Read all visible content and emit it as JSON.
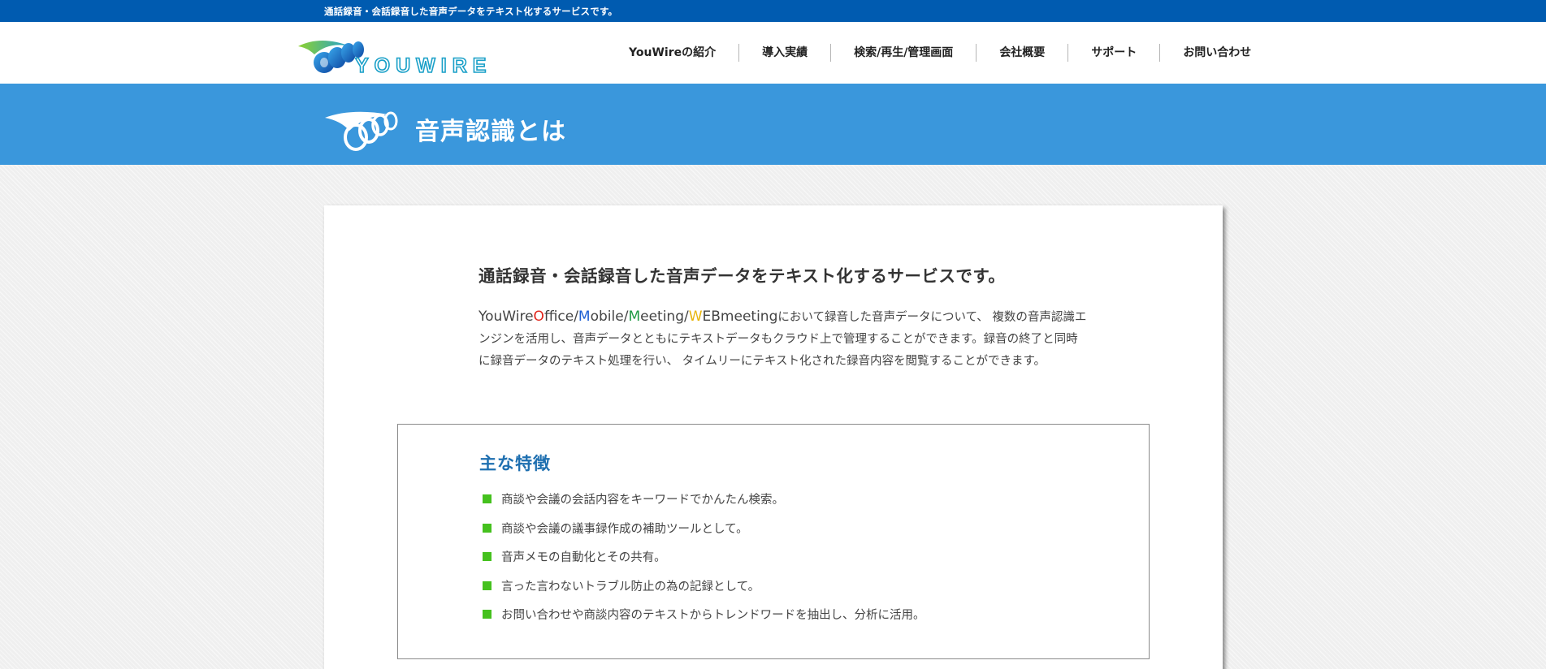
{
  "topbar": {
    "tagline": "通話録音・会話録音した音声データをテキスト化するサービスです。"
  },
  "header": {
    "logo_text": "YOUWIRE",
    "nav": [
      {
        "label": "YouWireの紹介"
      },
      {
        "label": "導入実績"
      },
      {
        "label": "検索/再生/管理画面"
      },
      {
        "label": "会社概要"
      },
      {
        "label": "サポート"
      },
      {
        "label": "お問い合わせ"
      }
    ]
  },
  "hero": {
    "title": "音声認識とは"
  },
  "main": {
    "lead_title": "通話録音・会話録音した音声データをテキスト化するサービスです。",
    "brand": {
      "you_wire": "YouWire",
      "o": "O",
      "ffice": "ffice",
      "m1": "M",
      "obile": "obile",
      "m2": "M",
      "eeting": "eeting",
      "w": "W",
      "ebmeeting": "EBmeeting",
      "slash": "/"
    },
    "description_rest": "において録音した音声データについて、 複数の音声認識エンジンを活用し、音声データとともにテキストデータもクラウド上で管理することができます。録音の終了と同時に録音データのテキスト処理を行い、 タイムリーにテキスト化された録音内容を閲覧することができます。",
    "features": {
      "title": "主な特徴",
      "items": [
        "商談や会議の会話内容をキーワードでかんたん検索。",
        "商談や会議の議事録作成の補助ツールとして。",
        "音声メモの自動化とその共有。",
        "言った言わないトラブル防止の為の記録として。",
        "お問い合わせや商談内容のテキストからトレンドワードを抽出し、分析に活用。"
      ]
    }
  },
  "colors": {
    "topbar": "#005bb0",
    "hero": "#3a97dc",
    "bullet": "#45c11e",
    "feature_title": "#1e6fb0",
    "brand_o": "#e1261c",
    "brand_m1": "#1d5fd3",
    "brand_m2": "#1f9a44",
    "brand_w": "#e8b50c"
  }
}
